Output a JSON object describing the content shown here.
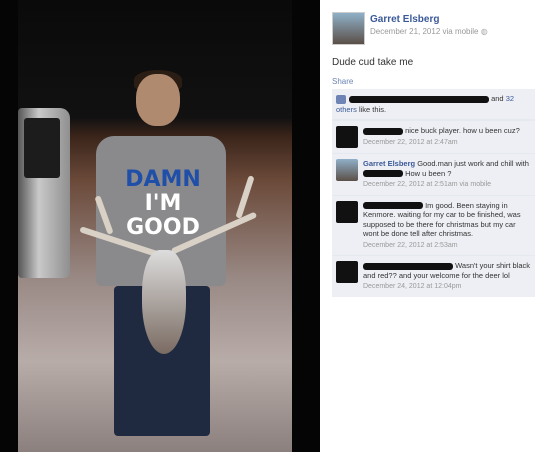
{
  "post": {
    "author": "Garret Elsberg",
    "date": "December 21, 2012 via mobile",
    "status": "Dude cud take me",
    "share_label": "Share",
    "likes_prefix": "and",
    "likes_count_link": "32 others",
    "likes_suffix": "like this."
  },
  "shirt": {
    "line1": "DAMN",
    "line2": "I'M",
    "line3": "GOOD"
  },
  "comments": [
    {
      "text": "nice buck player. how u been cuz?",
      "time": "December 22, 2012 at 2:47am"
    },
    {
      "author": "Garret Elsberg",
      "text": "Good.man just work and chill with",
      "text2": "How u been ?",
      "time": "December 22, 2012 at 2:51am via mobile"
    },
    {
      "text": "Im good. Been staying in Kenmore. waiting for my car to be finished, was supposed to be there for christmas but my car wont be done tell after christmas.",
      "time": "December 22, 2012 at 2:53am"
    },
    {
      "text": "Wasn't your shirt black and red?? and your welcome for the deer lol",
      "time": "December 24, 2012 at 12:04pm"
    }
  ],
  "icons": {
    "globe": "globe-icon",
    "like": "thumbs-up-icon"
  }
}
